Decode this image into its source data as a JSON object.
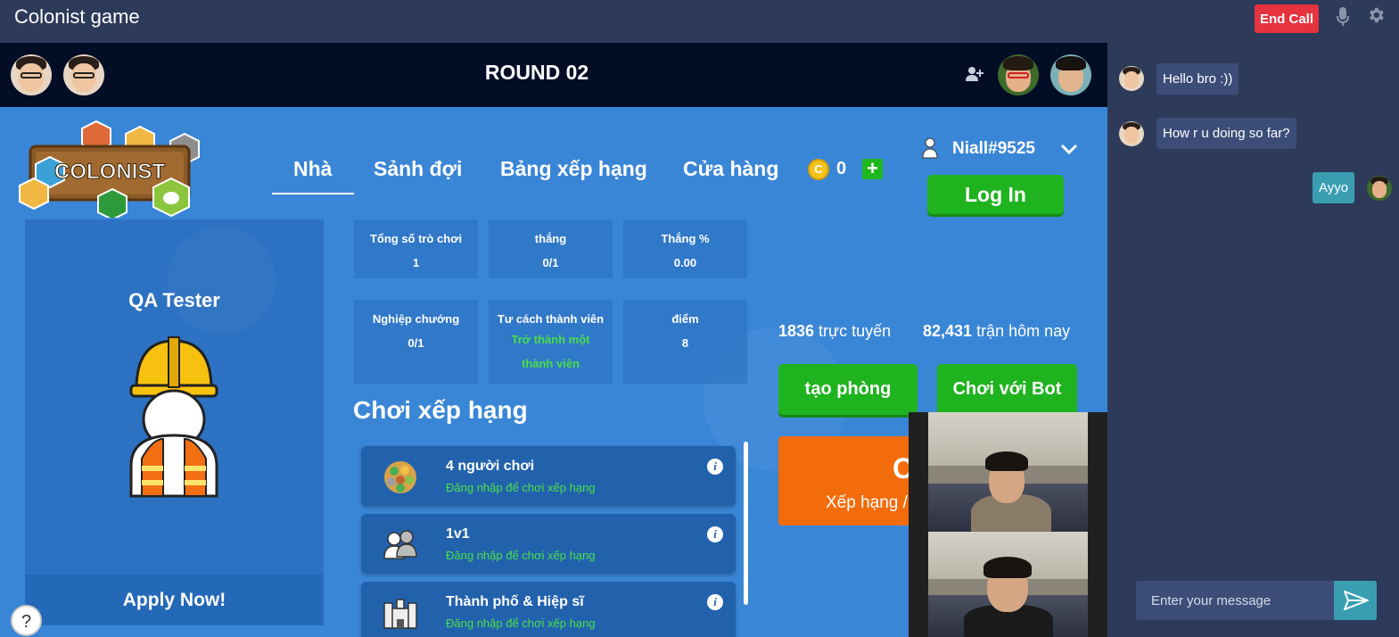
{
  "app": {
    "title": "Colonist game",
    "end_call_label": "End Call"
  },
  "game": {
    "round_title": "ROUND 02",
    "nav": [
      {
        "label": "Nhà",
        "active": true
      },
      {
        "label": "Sảnh đợi"
      },
      {
        "label": "Bảng xếp hạng"
      },
      {
        "label": "Cửa hàng"
      }
    ],
    "coins": "0",
    "coin_symbol": "C",
    "add_coin_symbol": "+",
    "username": "Niall#9525",
    "login_label": "Log In",
    "logo_text": "COLONIST",
    "profile": {
      "name": "QA Tester",
      "apply_label": "Apply Now!"
    },
    "stats": [
      {
        "label": "Tổng số trò chơi",
        "value": "1"
      },
      {
        "label": "thắng",
        "value": "0/1"
      },
      {
        "label": "Thắng %",
        "value": "0.00"
      },
      {
        "label": "Nghiệp chướng",
        "value": "0/1"
      },
      {
        "label": "Tư cách thành viên",
        "value": "Trở thành một thành viên"
      },
      {
        "label": "điểm",
        "value": "8"
      }
    ],
    "ranked_title": "Chơi xếp hạng",
    "modes": [
      {
        "name": "4 người chơi",
        "sub": "Đăng nhập để chơi xếp hạng"
      },
      {
        "name": "1v1",
        "sub": "Đăng nhập để chơi xếp hạng"
      },
      {
        "name": "Thành phố & Hiệp sĩ",
        "sub": "Đăng nhập để chơi xếp hạng"
      }
    ],
    "info_symbol": "i",
    "online": {
      "count": "1836",
      "label": " trực tuyến"
    },
    "matches": {
      "count": "82,431",
      "label": " trận hôm nay"
    },
    "create_room_label": "tạo phòng",
    "play_bot_label": "Chơi với Bot",
    "play_card": {
      "letter": "C",
      "sub": "Xếp hạng /"
    },
    "help_symbol": "?"
  },
  "chat": {
    "messages": [
      {
        "from": "other",
        "text": "Hello bro :))"
      },
      {
        "from": "other",
        "text": "How r u doing so far?"
      },
      {
        "from": "me",
        "text": "Ayyo"
      }
    ],
    "input_placeholder": "Enter your message"
  },
  "colors": {
    "game_bg": "#3a86d6",
    "round_bar": "#030d26",
    "chat_bg": "#2e3a59",
    "end_call": "#e5333f",
    "green_button": "#1fb31f",
    "orange_card": "#f26c0c",
    "accent_green_text": "#49e04a",
    "chat_out_bubble": "#3a9eb3"
  },
  "icons": [
    "mic-icon",
    "gear-icon",
    "add-user-icon",
    "user-icon",
    "chevron-down-icon",
    "coin-icon",
    "info-icon",
    "send-icon",
    "collapse-arrow-icon",
    "help-icon"
  ]
}
